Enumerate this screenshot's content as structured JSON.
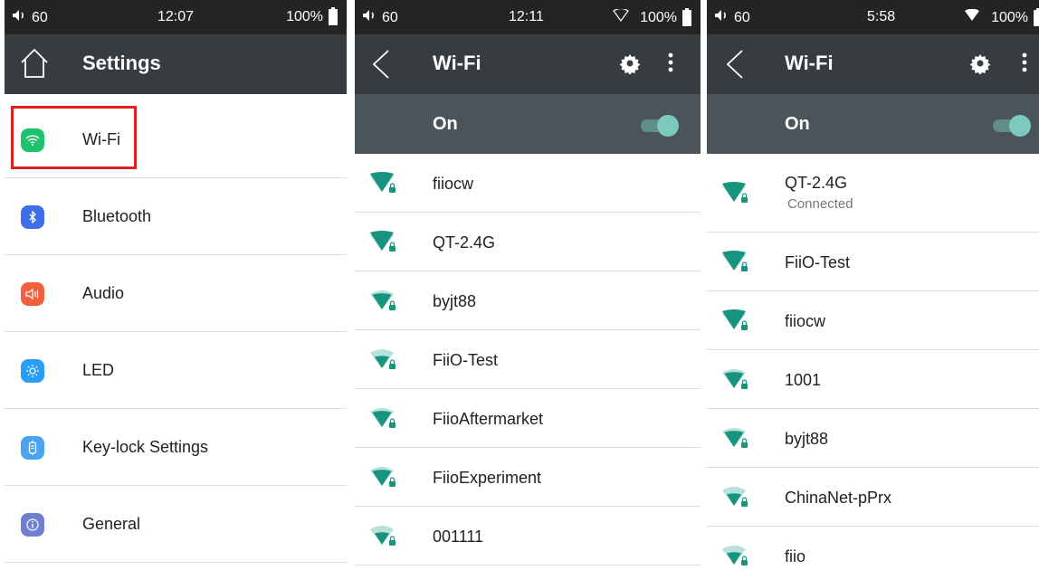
{
  "panels": [
    {
      "status": {
        "volume": "60",
        "time": "12:07",
        "battery": "100%"
      },
      "title": "Settings",
      "items": [
        {
          "label": "Wi-Fi",
          "icon": "wifi-icon",
          "color": "#1ec26b"
        },
        {
          "label": "Bluetooth",
          "icon": "bluetooth-icon",
          "color": "#3f6fe8"
        },
        {
          "label": "Audio",
          "icon": "speaker-icon",
          "color": "#f0603f"
        },
        {
          "label": "LED",
          "icon": "brightness-icon",
          "color": "#2a9df4"
        },
        {
          "label": "Key-lock Settings",
          "icon": "keylock-icon",
          "color": "#4aa3f0"
        },
        {
          "label": "General",
          "icon": "info-icon",
          "color": "#6e7fcf"
        }
      ]
    },
    {
      "status": {
        "volume": "60",
        "time": "12:11",
        "battery": "100%"
      },
      "title": "Wi-Fi",
      "switch_label": "On",
      "networks": [
        {
          "name": "fiiocw",
          "strength": 4
        },
        {
          "name": "QT-2.4G",
          "strength": 4
        },
        {
          "name": "byjt88",
          "strength": 3
        },
        {
          "name": "FiiO-Test",
          "strength": 2
        },
        {
          "name": "FiioAftermarket",
          "strength": 3
        },
        {
          "name": "FiioExperiment",
          "strength": 3
        },
        {
          "name": "001111",
          "strength": 2
        }
      ]
    },
    {
      "status": {
        "volume": "60",
        "time": "5:58",
        "battery": "100%"
      },
      "title": "Wi-Fi",
      "switch_label": "On",
      "networks": [
        {
          "name": "QT-2.4G",
          "status": "Connected",
          "strength": 4
        },
        {
          "name": "FiiO-Test",
          "strength": 4
        },
        {
          "name": "fiiocw",
          "strength": 4
        },
        {
          "name": "1001",
          "strength": 3
        },
        {
          "name": "byjt88",
          "strength": 3
        },
        {
          "name": "ChinaNet-pPrx",
          "strength": 2
        },
        {
          "name": "fiio",
          "strength": 2
        }
      ]
    }
  ],
  "colors": {
    "wifi_signal": "#17947f",
    "wifi_faint": "#b7e1da",
    "accent": "#7cc9c0"
  }
}
